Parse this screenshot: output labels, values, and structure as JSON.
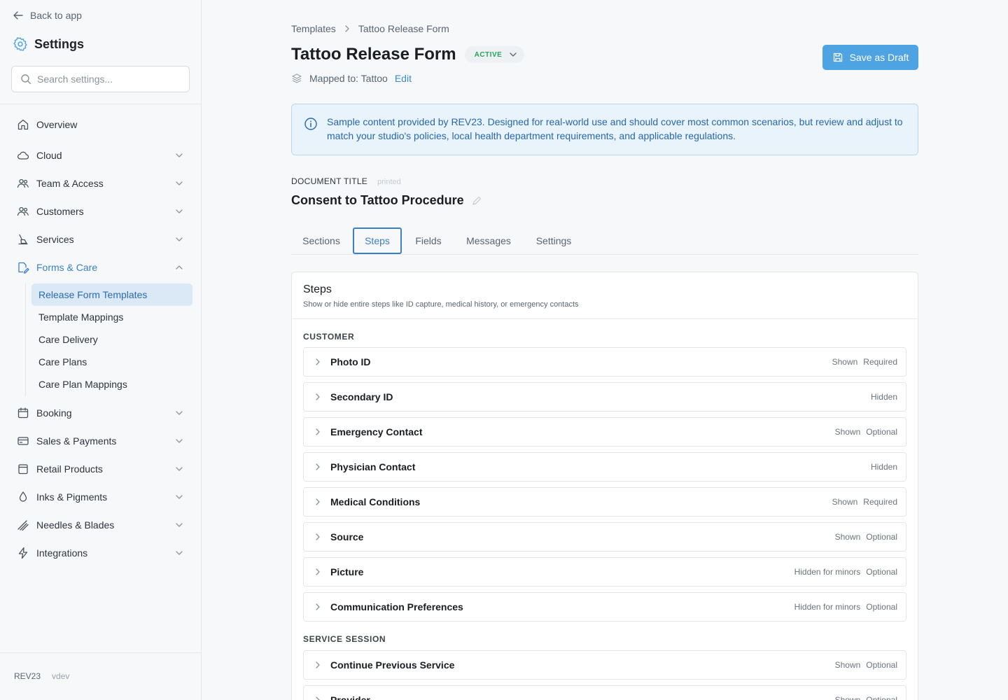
{
  "sidebar": {
    "back_label": "Back to app",
    "title": "Settings",
    "search_placeholder": "Search settings...",
    "items": [
      {
        "label": "Overview",
        "icon": "home-icon"
      },
      {
        "label": "Cloud",
        "icon": "cloud-icon"
      },
      {
        "label": "Team & Access",
        "icon": "team-icon"
      },
      {
        "label": "Customers",
        "icon": "customers-icon"
      },
      {
        "label": "Services",
        "icon": "tattoo-machine-icon"
      },
      {
        "label": "Forms & Care",
        "icon": "forms-icon"
      },
      {
        "label": "Booking",
        "icon": "calendar-icon"
      },
      {
        "label": "Sales & Payments",
        "icon": "credit-card-icon"
      },
      {
        "label": "Retail Products",
        "icon": "bag-icon"
      },
      {
        "label": "Inks & Pigments",
        "icon": "ink-drop-icon"
      },
      {
        "label": "Needles & Blades",
        "icon": "needles-icon"
      },
      {
        "label": "Integrations",
        "icon": "lightning-icon"
      }
    ],
    "subitems": [
      {
        "label": "Release Form Templates"
      },
      {
        "label": "Template Mappings"
      },
      {
        "label": "Care Delivery"
      },
      {
        "label": "Care Plans"
      },
      {
        "label": "Care Plan Mappings"
      }
    ],
    "footer": {
      "brand": "REV23",
      "version": "vdev"
    }
  },
  "breadcrumb": {
    "parent": "Templates",
    "current": "Tattoo Release Form"
  },
  "header": {
    "title": "Tattoo Release Form",
    "status": "ACTIVE",
    "mapped_label": "Mapped to: Tattoo",
    "edit_label": "Edit",
    "save_label": "Save as Draft"
  },
  "info_banner": "Sample content provided by REV23. Designed for real-world use and should cover most common scenarios, but review and adjust to match your studio's policies, local health department requirements, and applicable regulations.",
  "document": {
    "label": "DOCUMENT TITLE",
    "printed_note": "printed",
    "title": "Consent to Tattoo Procedure"
  },
  "tabs": [
    {
      "label": "Sections"
    },
    {
      "label": "Steps"
    },
    {
      "label": "Fields"
    },
    {
      "label": "Messages"
    },
    {
      "label": "Settings"
    }
  ],
  "steps_card": {
    "title": "Steps",
    "description": "Show or hide entire steps like ID capture, medical history, or emergency contacts",
    "groups": [
      {
        "label": "CUSTOMER",
        "steps": [
          {
            "name": "Photo ID",
            "visibility": "Shown",
            "requirement": "Required"
          },
          {
            "name": "Secondary ID",
            "visibility": "Hidden",
            "requirement": ""
          },
          {
            "name": "Emergency Contact",
            "visibility": "Shown",
            "requirement": "Optional"
          },
          {
            "name": "Physician Contact",
            "visibility": "Hidden",
            "requirement": ""
          },
          {
            "name": "Medical Conditions",
            "visibility": "Shown",
            "requirement": "Required"
          },
          {
            "name": "Source",
            "visibility": "Shown",
            "requirement": "Optional"
          },
          {
            "name": "Picture",
            "visibility": "Hidden for minors",
            "requirement": "Optional"
          },
          {
            "name": "Communication Preferences",
            "visibility": "Hidden for minors",
            "requirement": "Optional"
          }
        ]
      },
      {
        "label": "SERVICE SESSION",
        "steps": [
          {
            "name": "Continue Previous Service",
            "visibility": "Shown",
            "requirement": "Optional"
          },
          {
            "name": "Provider",
            "visibility": "Shown",
            "requirement": "Optional"
          }
        ]
      }
    ]
  },
  "colors": {
    "accent": "#3b7fc4",
    "save_button": "#4ea3e3",
    "active_status": "#23a55a",
    "info_bg": "#e9f3fc"
  }
}
